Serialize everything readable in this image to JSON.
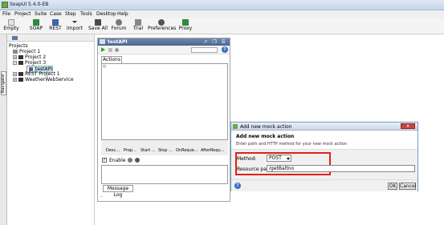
{
  "window": {
    "title": "SoapUI 5.4.0-EB"
  },
  "menu": [
    "File",
    "Project",
    "Suite",
    "Case",
    "Step",
    "Tools",
    "Desktop",
    "Help"
  ],
  "toolbar": {
    "empty": "Empty",
    "soap": "SOAP",
    "rest": "REST",
    "import": "Import",
    "save_all": "Save All",
    "forum": "Forum",
    "trial": "Trial",
    "preferences": "Preferences",
    "proxy": "Proxy"
  },
  "navigator": {
    "tab_label": "Navigator",
    "root": "Projects",
    "items": [
      "Project 1",
      "Project 2",
      "Project 3",
      "testAPI",
      "REST Project 1",
      "WeatherWebService"
    ]
  },
  "mock_panel": {
    "title": "testAPI",
    "header_controls": "↗ ❐ ☰",
    "help": "?",
    "tab_actions": "Actions",
    "actions_placeholder": "!!",
    "buttons": [
      "Desc...",
      "Prop...",
      "Start ...",
      "Stop ...",
      "OnReque...",
      "AfterRequ..."
    ],
    "enable_label": "Enable",
    "message_log": "Message Log",
    "footer": "..."
  },
  "dialog": {
    "title": "Add new mock action",
    "close_label": "x",
    "heading": "Add new mock action",
    "subheading": "Enter path and HTTP method for your new mock action",
    "method_label": "Method:",
    "method_value": "POST",
    "resource_label": "Resource path:",
    "resource_value": "/getBaltno",
    "help": "?",
    "ok": "OK",
    "cancel": "Cancel"
  },
  "colors": {
    "highlight": "#e0201a",
    "selection": "#c5d9f1",
    "panel_header": "#4b678f"
  }
}
